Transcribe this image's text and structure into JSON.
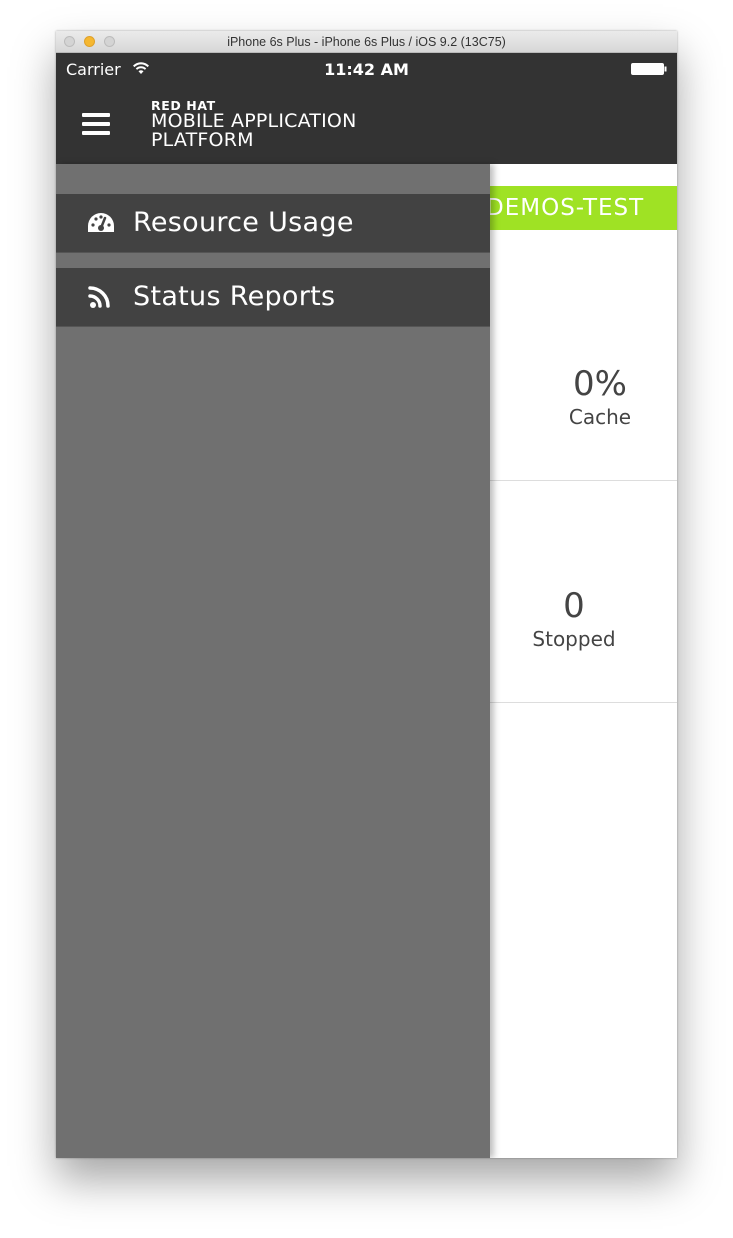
{
  "window": {
    "title": "iPhone 6s Plus - iPhone 6s Plus / iOS 9.2 (13C75)"
  },
  "statusbar": {
    "carrier": "Carrier",
    "time": "11:42 AM"
  },
  "header": {
    "brand_top": "RED HAT",
    "brand_line1": "MOBILE APPLICATION",
    "brand_line2": "PLATFORM"
  },
  "drawer": {
    "items": [
      {
        "label": "Resource Usage",
        "icon": "dashboard-icon"
      },
      {
        "label": "Status Reports",
        "icon": "rss-feed-icon"
      }
    ]
  },
  "content": {
    "environment": "DEMOS-TEST",
    "stats": [
      {
        "value": "0%",
        "label": "Cache"
      },
      {
        "value": "0",
        "label": "Stopped"
      }
    ]
  },
  "colors": {
    "header_bg": "#333333",
    "drawer_bg": "#707070",
    "drawer_item_bg": "#424242",
    "env_banner": "#9fe224"
  }
}
